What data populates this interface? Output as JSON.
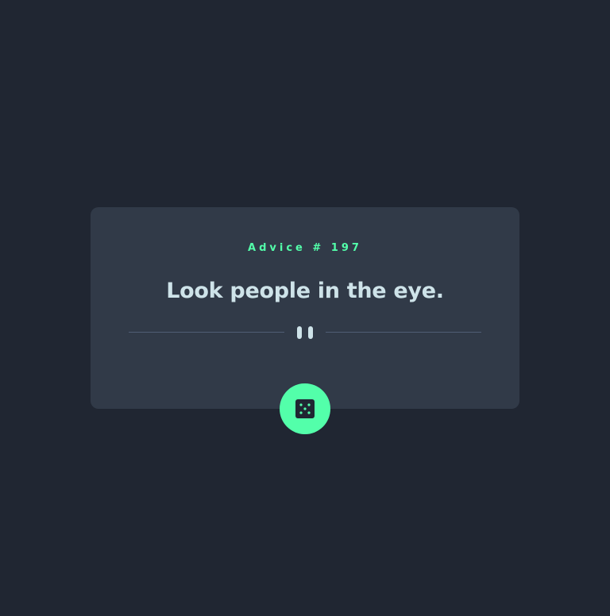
{
  "advice": {
    "id_label": "Advice # 197",
    "text": "Look people in the eye."
  },
  "icons": {
    "divider": "pause-divider-icon",
    "dice": "dice-icon"
  },
  "colors": {
    "background": "#202632",
    "card": "#313A48",
    "accent": "#53FFAA",
    "text": "#CEE3E9",
    "divider": "#4F5D74"
  }
}
